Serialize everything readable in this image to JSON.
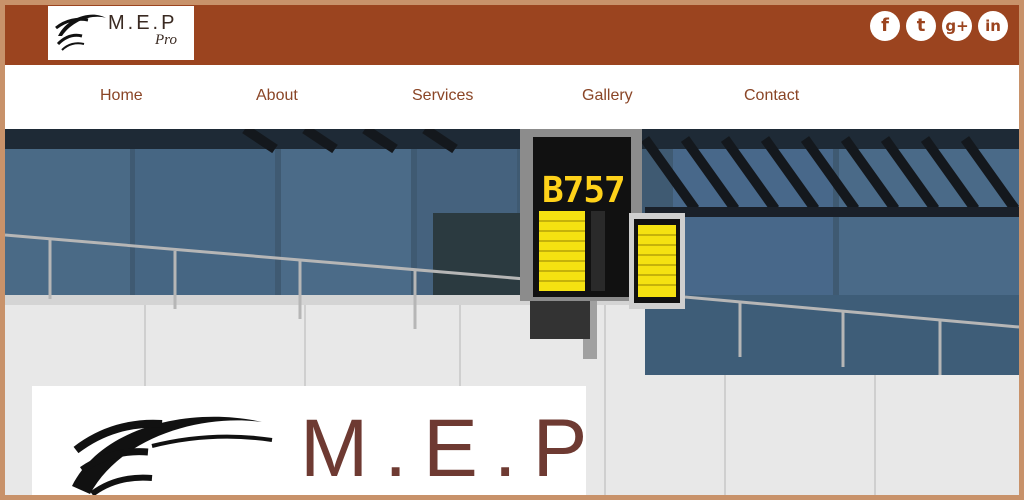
{
  "header": {
    "logo": {
      "name": "M.E.P",
      "sub": "Pro"
    },
    "social": [
      {
        "icon": "facebook-icon",
        "glyph": "f"
      },
      {
        "icon": "twitter-icon",
        "glyph": "t"
      },
      {
        "icon": "google-plus-icon",
        "glyph": "g+"
      },
      {
        "icon": "linkedin-icon",
        "glyph": "in"
      }
    ]
  },
  "nav": {
    "items": [
      {
        "label": "Home"
      },
      {
        "label": "About"
      },
      {
        "label": "Services"
      },
      {
        "label": "Gallery"
      },
      {
        "label": "Contact"
      }
    ]
  },
  "hero": {
    "sign_text": "B757",
    "logo_text": "M.E.P"
  },
  "colors": {
    "frame": "#c8926a",
    "topbar": "#9b441f",
    "nav_text": "#8a4526",
    "logo_text": "#6e3a32",
    "sign_led": "#ffd21a"
  }
}
